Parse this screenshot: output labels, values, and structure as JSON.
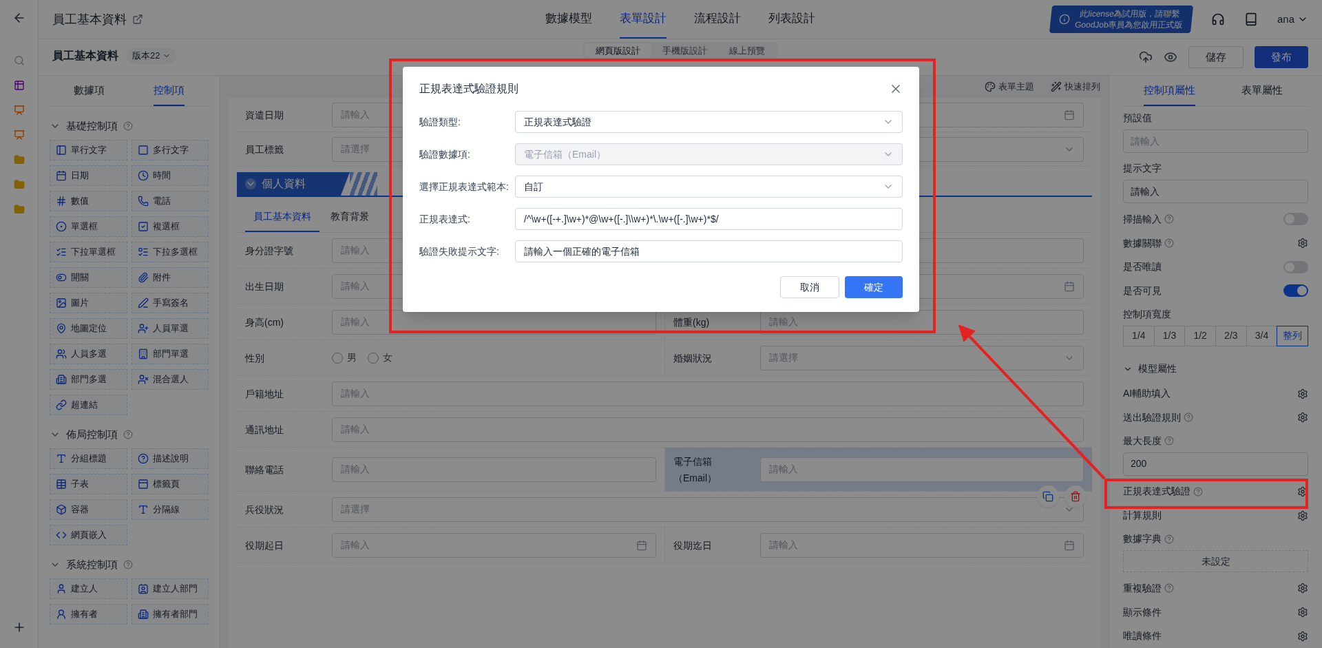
{
  "top_bar": {
    "title": "員工基本資料",
    "tabs": [
      {
        "label": "數據模型",
        "selected": false
      },
      {
        "label": "表單設計",
        "selected": true
      },
      {
        "label": "流程設計",
        "selected": false
      },
      {
        "label": "列表設計",
        "selected": false
      }
    ],
    "license_notice": [
      "此license為試用版，請聯繫",
      "GoodJob專員為您啟用正式版"
    ],
    "user": "ana"
  },
  "sub_bar": {
    "title": "員工基本資料",
    "version": "版本22",
    "modes": [
      {
        "label": "網頁版設計",
        "selected": true
      },
      {
        "label": "手機版設計",
        "selected": false
      },
      {
        "label": "線上預覽",
        "selected": false
      }
    ],
    "save": "儲存",
    "publish": "發布"
  },
  "left_panel": {
    "tabs": [
      {
        "label": "數據項",
        "selected": false
      },
      {
        "label": "控制項",
        "selected": true
      }
    ],
    "groups": [
      {
        "title": "基礎控制項",
        "expanded": true,
        "items": [
          "單行文字",
          "多行文字",
          "日期",
          "時間",
          "數值",
          "電話",
          "單選框",
          "複選框",
          "下拉單選框",
          "下拉多選框",
          "開關",
          "附件",
          "圖片",
          "手寫簽名",
          "地圖定位",
          "人員單選",
          "人員多選",
          "部門單選",
          "部門多選",
          "混合選人",
          "超連結"
        ]
      },
      {
        "title": "佈局控制項",
        "expanded": true,
        "items": [
          "分組標題",
          "描述說明",
          "子表",
          "標籤頁",
          "容器",
          "分隔線",
          "網頁嵌入"
        ]
      },
      {
        "title": "系統控制項",
        "expanded": true,
        "items": [
          "建立人",
          "建立人部門",
          "擁有者",
          "擁有者部門"
        ]
      }
    ]
  },
  "canvas": {
    "toolbar": [
      "表單主題",
      "快速排列"
    ],
    "top_rows": [
      {
        "cells": [
          {
            "label": "資遣日期",
            "kind": "date",
            "placeholder": "請輸入",
            "selected": false
          }
        ]
      },
      {
        "cells": [
          {
            "label": "員工標籤",
            "kind": "select",
            "placeholder": "請選擇",
            "selected": false
          }
        ]
      }
    ],
    "section": {
      "title": "個人資料",
      "expanded": true,
      "tabs": [
        {
          "label": "員工基本資料",
          "selected": true
        },
        {
          "label": "教育背景",
          "selected": false
        }
      ]
    },
    "rows": [
      {
        "cells": [
          {
            "label": "身分證字號",
            "kind": "text",
            "placeholder": "請輸入",
            "selected": false
          },
          {
            "kind": "text",
            "selected": false
          }
        ]
      },
      {
        "cells": [
          {
            "label": "出生日期",
            "kind": "date",
            "placeholder": "請輸入",
            "selected": false
          },
          {
            "kind": "date",
            "selected": false
          }
        ]
      },
      {
        "cells": [
          {
            "label": "身高(cm)",
            "kind": "text",
            "placeholder": "請輸入",
            "selected": false
          },
          {
            "label": "體重(kg)",
            "kind": "text",
            "placeholder": "請輸入",
            "selected": false
          }
        ]
      },
      {
        "cells": [
          {
            "label": "性別",
            "kind": "radio",
            "options": [
              {
                "label": "男",
                "checked": false
              },
              {
                "label": "女",
                "checked": false
              }
            ],
            "selected": false
          },
          {
            "label": "婚姻狀況",
            "kind": "select",
            "placeholder": "請選擇",
            "selected": false
          }
        ]
      },
      {
        "cells": [
          {
            "label": "戶籍地址",
            "kind": "text",
            "placeholder": "請輸入",
            "selected": false
          }
        ]
      },
      {
        "cells": [
          {
            "label": "通訊地址",
            "kind": "text",
            "placeholder": "請輸入",
            "selected": false
          }
        ]
      },
      {
        "cells": [
          {
            "label": "聯絡電話",
            "kind": "text",
            "placeholder": "請輸入",
            "selected": false
          },
          {
            "label": "電子信箱（Email）",
            "kind": "text",
            "placeholder": "請輸入",
            "selected": true
          }
        ]
      },
      {
        "cells": [
          {
            "label": "兵役狀況",
            "kind": "select",
            "placeholder": "請選擇",
            "selected": false
          }
        ]
      },
      {
        "cells": [
          {
            "label": "役期起日",
            "kind": "date",
            "placeholder": "請輸入",
            "selected": false
          },
          {
            "label": "役期迄日",
            "kind": "date",
            "placeholder": "請輸入",
            "selected": false
          }
        ]
      }
    ]
  },
  "properties": {
    "tabs": [
      {
        "label": "控制項屬性",
        "selected": true
      },
      {
        "label": "表單屬性",
        "selected": false
      }
    ],
    "items": [
      {
        "kind": "input",
        "label": "預設值",
        "placeholder": "請輸入",
        "help": false
      },
      {
        "kind": "input",
        "label": "提示文字",
        "value": "請輸入",
        "help": false
      },
      {
        "kind": "toggle",
        "label": "掃描輸入",
        "help": true,
        "on": false
      },
      {
        "kind": "gear",
        "label": "數據關聯",
        "help": true
      },
      {
        "kind": "toggle",
        "label": "是否唯讀",
        "help": false,
        "on": false
      },
      {
        "kind": "toggle",
        "label": "是否可見",
        "help": false,
        "on": true
      },
      {
        "kind": "widths",
        "label": "控制項寬度",
        "help": false,
        "options": [
          {
            "label": "1/4",
            "selected": false
          },
          {
            "label": "1/3",
            "selected": false
          },
          {
            "label": "1/2",
            "selected": false
          },
          {
            "label": "2/3",
            "selected": false
          },
          {
            "label": "3/4",
            "selected": false
          },
          {
            "label": "整列",
            "selected": true
          }
        ]
      },
      {
        "kind": "section",
        "label": "模型屬性",
        "expanded": true
      },
      {
        "kind": "gear",
        "label": "AI輔助填入",
        "help": false
      },
      {
        "kind": "gear",
        "label": "送出驗證規則",
        "help": true
      },
      {
        "kind": "input",
        "label": "最大長度",
        "help": true,
        "value": "200"
      },
      {
        "kind": "gear",
        "label": "正規表達式驗證",
        "help": true
      },
      {
        "kind": "gear",
        "label": "計算規則",
        "help": false
      },
      {
        "kind": "dict",
        "label": "數據字典",
        "help": true,
        "value": "未設定"
      },
      {
        "kind": "gear",
        "label": "重複驗證",
        "help": true
      },
      {
        "kind": "gear",
        "label": "顯示條件",
        "help": false
      },
      {
        "kind": "gear",
        "label": "唯讀條件",
        "help": false
      }
    ]
  },
  "dialog": {
    "title": "正規表達式驗證規則",
    "fields": [
      {
        "label": "驗證類型:",
        "kind": "select",
        "value": "正規表達式驗證",
        "disabled": false
      },
      {
        "label": "驗證數據項:",
        "kind": "select",
        "value": "電子信箱（Email）",
        "disabled": true
      },
      {
        "label": "選擇正規表達式範本:",
        "kind": "select",
        "value": "自訂",
        "disabled": false
      },
      {
        "label": "正規表達式:",
        "kind": "input",
        "value": "/^\\w+([-+.]\\w+)*@\\w+([-.]\\\\w+)*\\.\\w+([-.]\\w+)*$/",
        "disabled": false
      },
      {
        "label": "驗證失敗提示文字:",
        "kind": "input",
        "value": "請輸入一個正確的電子信箱",
        "disabled": false
      }
    ],
    "cancel": "取消",
    "confirm": "確定"
  }
}
